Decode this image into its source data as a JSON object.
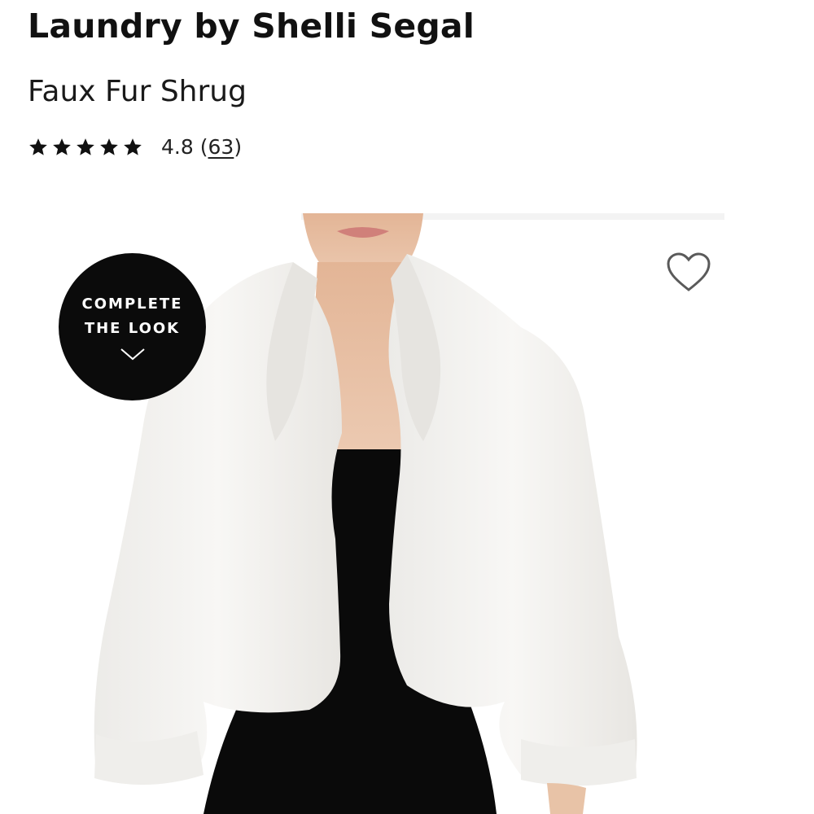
{
  "product": {
    "brand": "Laundry by Shelli Segal",
    "name": "Faux Fur Shrug"
  },
  "rating": {
    "stars_filled": 5,
    "stars_total": 5,
    "value": "4.8",
    "count_open": "(",
    "count": "63",
    "count_close": ")"
  },
  "image": {
    "description_icon": "product-photo",
    "wishlist_icon": "heart-outline-icon"
  },
  "complete_the_look": {
    "line1": "COMPLETE",
    "line2": "THE LOOK",
    "icon": "chevron-down-icon"
  },
  "colors": {
    "badge_bg": "#0b0b0b",
    "badge_text": "#ffffff",
    "text": "#111111",
    "fur": "#f4f2ef",
    "dress": "#0a0a0a",
    "skin": "#e9c0a4"
  }
}
